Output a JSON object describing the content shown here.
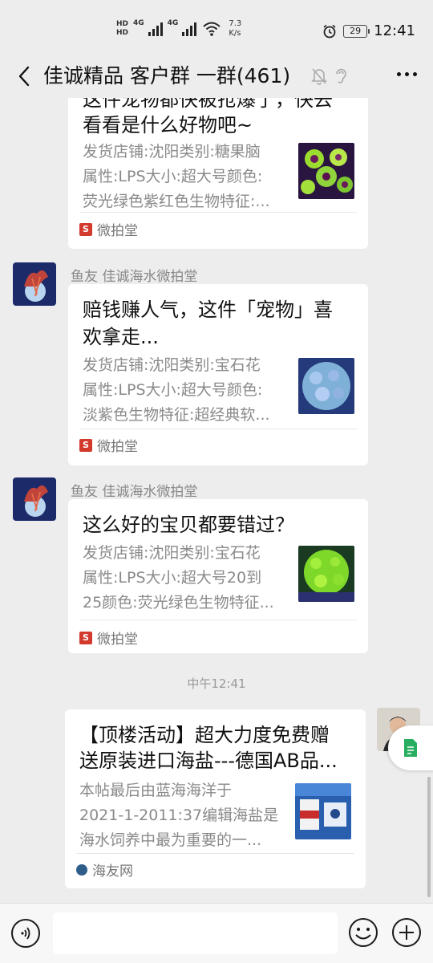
{
  "status_bar": {
    "hd1": "HD",
    "hd2": "HD",
    "net1": "4G",
    "net2": "4G",
    "speed_value": "7.3",
    "speed_unit": "K/s",
    "battery": "29",
    "time": "12:41"
  },
  "nav": {
    "title": "佳诚精品 客户群 一群(461)"
  },
  "messages": [
    {
      "title_line1": "这件宠物都快被抢爆了，快去",
      "title_line2": "看看是什么好物吧~",
      "desc_line1": "发货店铺:沈阳类别:糖果脑",
      "desc_line2": "属性:LPS大小:超大号颜色:",
      "desc_line3": "荧光绿色紫红色生物特征:...",
      "source": "微拍堂",
      "thumb_color": "green-purple coral"
    },
    {
      "sender": "鱼友 佳诚海水微拍堂",
      "title_line1": "赔钱赚人气，这件「宠物」喜",
      "title_line2": "欢拿走...",
      "desc_line1": "发货店铺:沈阳类别:宝石花",
      "desc_line2": "属性:LPS大小:超大号颜色:",
      "desc_line3": "淡紫色生物特征:超经典软...",
      "source": "微拍堂",
      "thumb_color": "lavender coral"
    },
    {
      "sender": "鱼友 佳诚海水微拍堂",
      "title_line1": "这么好的宝贝都要错过？",
      "desc_line1": "发货店铺:沈阳类别:宝石花",
      "desc_line2": "属性:LPS大小:超大号20到",
      "desc_line3": "25颜色:荧光绿色生物特征...",
      "source": "微拍堂",
      "thumb_color": "fluorescent green coral"
    }
  ],
  "timestamp": "中午12:41",
  "own_message": {
    "title_line1": "【顶楼活动】超大力度免费赠",
    "title_line2": "送原装进口海盐---德国AB品...",
    "desc_line1": "本帖最后由蓝海海洋于",
    "desc_line2": "2021-1-2011:37编辑海盐是",
    "desc_line3": "海水饲养中最为重要的一...",
    "source": "海友网"
  },
  "icons": {
    "back": "chevron-left-icon",
    "mute": "bell-off-icon",
    "ear": "ear-icon",
    "more": "more-icon",
    "voice": "voice-icon",
    "emoji": "emoji-icon",
    "plus": "plus-icon",
    "doc": "document-icon"
  },
  "colors": {
    "background": "#ededed",
    "card": "#ffffff",
    "source_logo": "#d23a2e",
    "doc_icon": "#27ae60"
  }
}
